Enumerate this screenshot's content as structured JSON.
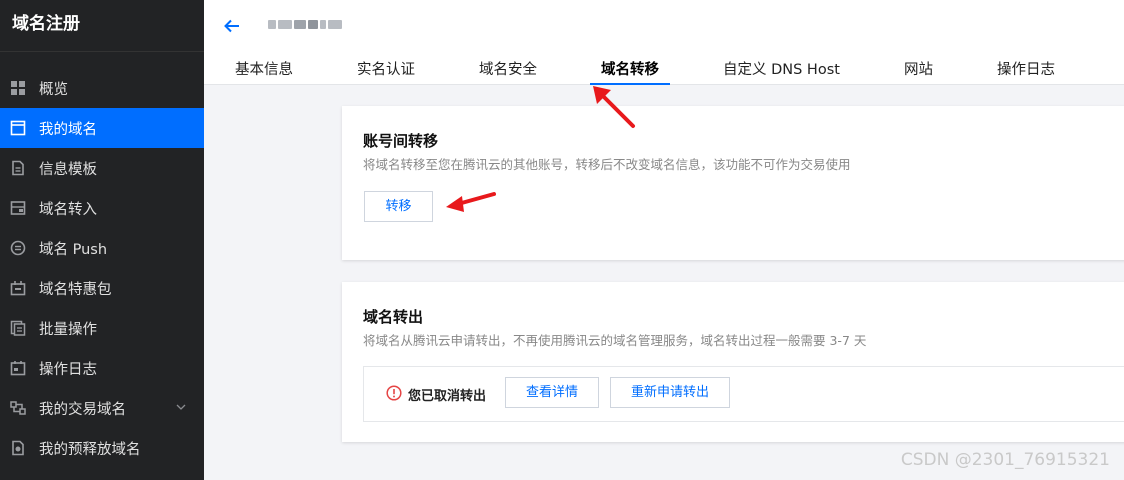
{
  "sidebar": {
    "title": "域名注册",
    "items": [
      {
        "label": "概览",
        "icon": "dashboard-icon"
      },
      {
        "label": "我的域名",
        "icon": "window-icon",
        "active": true
      },
      {
        "label": "信息模板",
        "icon": "document-icon"
      },
      {
        "label": "域名转入",
        "icon": "transfer-in-icon"
      },
      {
        "label": "域名 Push",
        "icon": "push-icon"
      },
      {
        "label": "域名特惠包",
        "icon": "package-icon"
      },
      {
        "label": "批量操作",
        "icon": "batch-icon"
      },
      {
        "label": "操作日志",
        "icon": "calendar-icon"
      },
      {
        "label": "我的交易域名",
        "icon": "trade-icon"
      },
      {
        "label": "我的预释放域名",
        "icon": "release-icon"
      }
    ]
  },
  "header": {
    "tabs": [
      "基本信息",
      "实名认证",
      "域名安全",
      "域名转移",
      "自定义 DNS Host",
      "网站",
      "操作日志"
    ],
    "active_tab": "域名转移"
  },
  "account_transfer": {
    "title": "账号间转移",
    "description": "将域名转移至您在腾讯云的其他账号，转移后不改变域名信息，该功能不可作为交易使用",
    "button": "转移"
  },
  "domain_out": {
    "title": "域名转出",
    "description": "将域名从腾讯云申请转出，不再使用腾讯云的域名管理服务，域名转出过程一般需要 3-7 天",
    "status": "您已取消转出",
    "detail_button": "查看详情",
    "reapply_button": "重新申请转出"
  },
  "watermark": "CSDN @2301_76915321",
  "colors": {
    "accent": "#006eff",
    "sidebar_bg": "#222325",
    "annotation_arrow": "#e8191c",
    "warning": "#e54545"
  }
}
